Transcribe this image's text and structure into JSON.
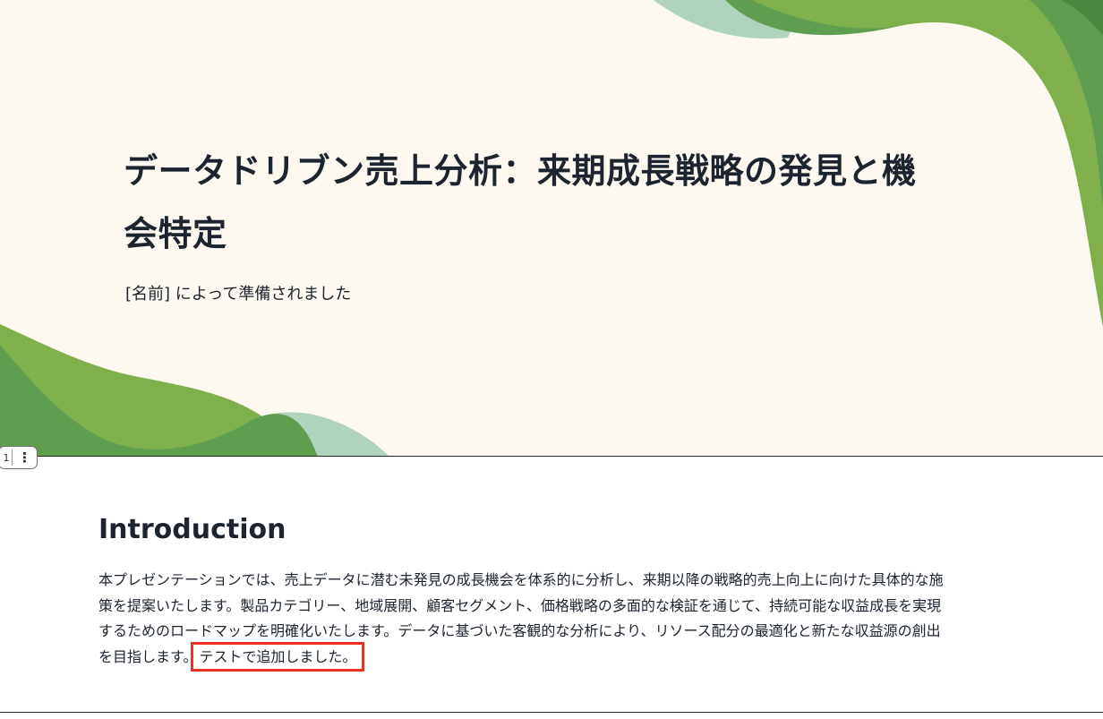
{
  "title_slide": {
    "title": "データドリブン売上分析：来期成長戦略の発見と機会特定",
    "subtitle": "[名前] によって準備されました"
  },
  "slide_tab": {
    "number": "1",
    "menu_glyph": "⋮"
  },
  "intro_slide": {
    "heading": "Introduction",
    "body": "本プレゼンテーションでは、売上データに潜む未発見の成長機会を体系的に分析し、来期以降の戦略的売上向上に向けた具体的な施策を提案いたします。製品カテゴリー、地域展開、顧客セグメント、価格戦略の多面的な検証を通じて、持続可能な収益成長を実現するためのロードマップを明確化いたします。データに基づいた客観的な分析により、リソース配分の最適化と新たな収益源の創出を目指します。",
    "highlighted_text": "テストで追加しました。"
  },
  "colors": {
    "background_cream": "#fdf8f0",
    "green_dark": "#5f9e4e",
    "green_light": "#7fb04c",
    "green_pale": "#b0d3bd",
    "text_dark": "#1c2430",
    "highlight_red": "#ea3323"
  }
}
